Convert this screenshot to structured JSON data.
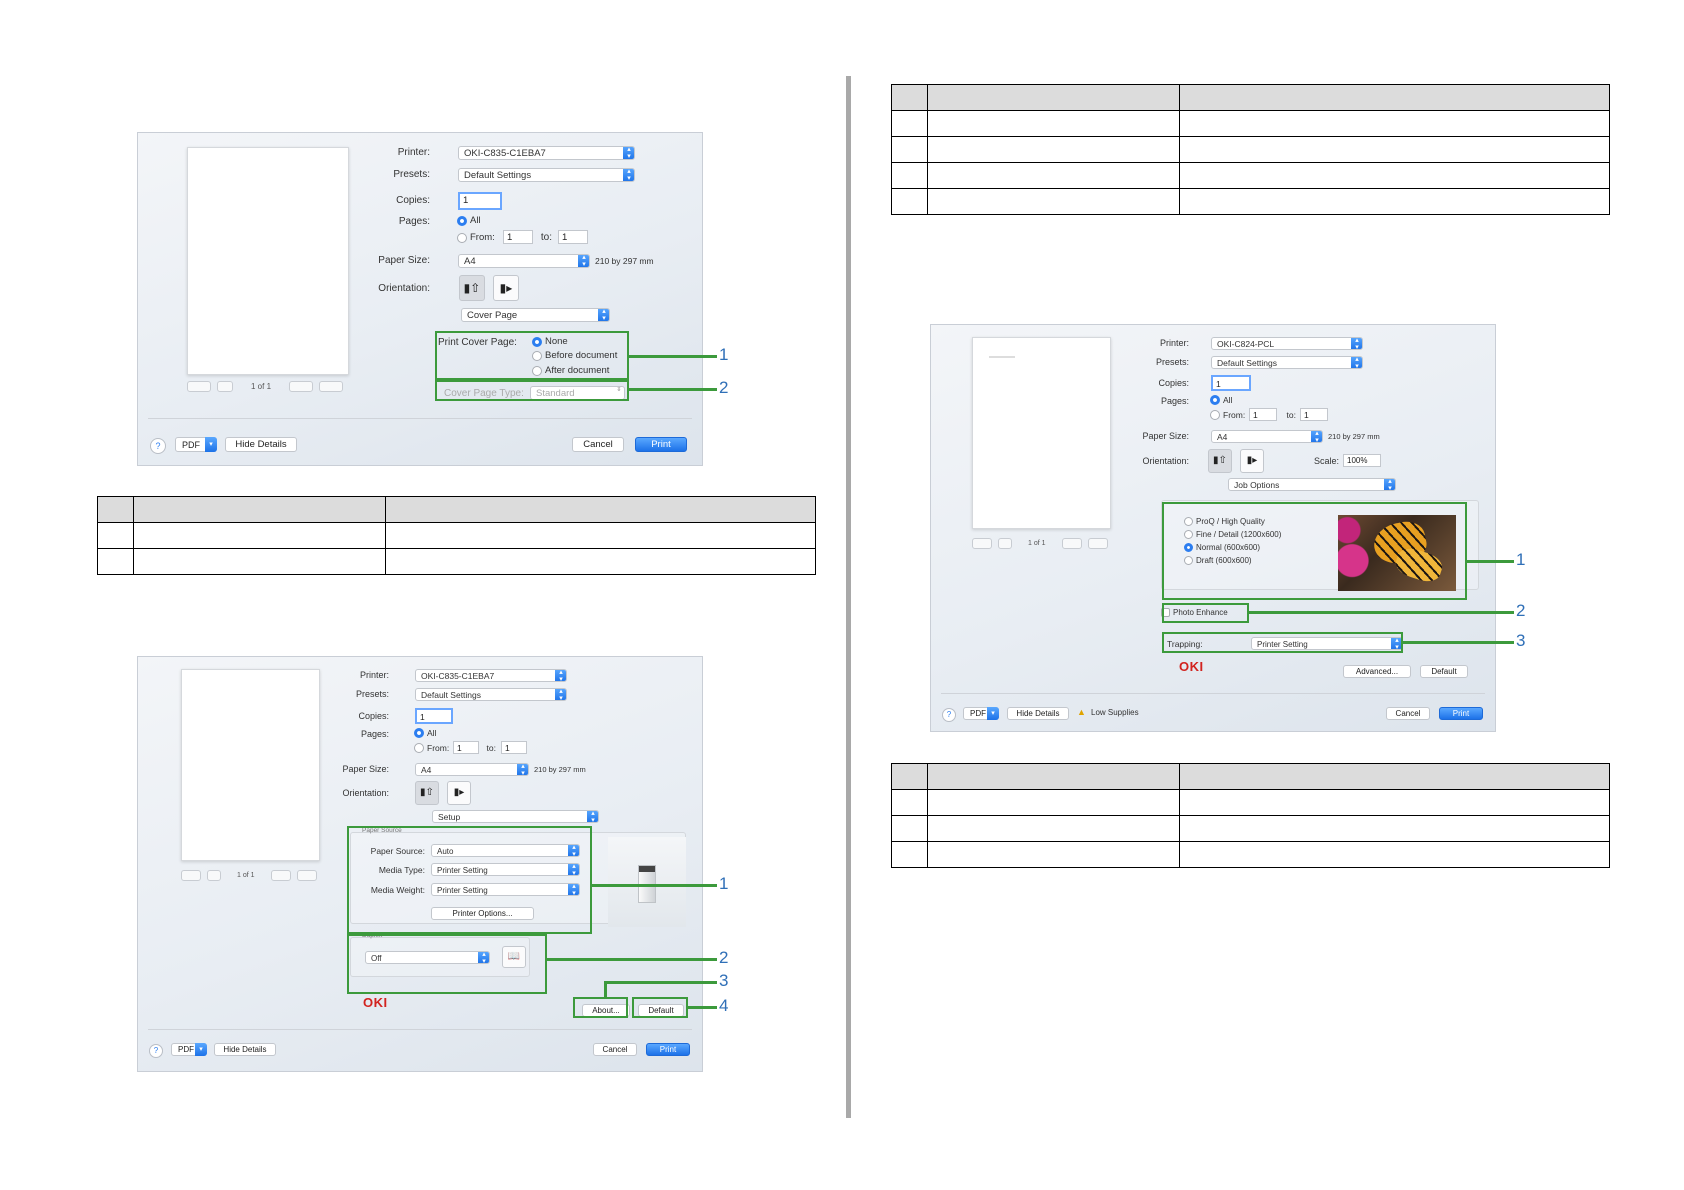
{
  "dialog_a": {
    "printer_label": "Printer:",
    "printer_value": "OKI-C835-C1EBA7",
    "presets_label": "Presets:",
    "presets_value": "Default Settings",
    "copies_label": "Copies:",
    "copies_value": "1",
    "pages_label": "Pages:",
    "pages_all": "All",
    "pages_from": "From:",
    "from_value": "1",
    "pages_to": "to:",
    "to_value": "1",
    "paper_size_label": "Paper Size:",
    "paper_size_value": "A4",
    "paper_size_dims": "210 by 297 mm",
    "orientation_label": "Orientation:",
    "panel_value": "Cover Page",
    "cover_page_label": "Print Cover Page:",
    "cover_none": "None",
    "cover_before": "Before document",
    "cover_after": "After document",
    "cover_type_label": "Cover Page Type:",
    "cover_type_value": "Standard",
    "page_count": "1 of 1",
    "pdf": "PDF",
    "hide_details": "Hide Details",
    "cancel": "Cancel",
    "print": "Print",
    "help": "?",
    "callouts": [
      "1",
      "2"
    ]
  },
  "dialog_b": {
    "printer_label": "Printer:",
    "printer_value": "OKI-C835-C1EBA7",
    "presets_label": "Presets:",
    "presets_value": "Default Settings",
    "copies_label": "Copies:",
    "copies_value": "1",
    "pages_label": "Pages:",
    "pages_all": "All",
    "pages_from": "From:",
    "from_value": "1",
    "pages_to": "to:",
    "to_value": "1",
    "paper_size_label": "Paper Size:",
    "paper_size_value": "A4",
    "paper_size_dims": "210 by 297 mm",
    "orientation_label": "Orientation:",
    "panel_value": "Setup",
    "paper_source_group": "Paper Source",
    "paper_source_label": "Paper Source:",
    "paper_source_value": "Auto",
    "media_type_label": "Media Type:",
    "media_type_value": "Printer Setting",
    "media_weight_label": "Media Weight:",
    "media_weight_value": "Printer Setting",
    "printer_options": "Printer Options...",
    "duplex_group": "Duplex",
    "duplex_value": "Off",
    "about": "About...",
    "default": "Default",
    "logo": "OKI",
    "page_count": "1 of 1",
    "pdf": "PDF",
    "hide_details": "Hide Details",
    "cancel": "Cancel",
    "print": "Print",
    "help": "?",
    "callouts": [
      "1",
      "2",
      "3",
      "4"
    ]
  },
  "dialog_c": {
    "printer_label": "Printer:",
    "printer_value": "OKI-C824-PCL",
    "presets_label": "Presets:",
    "presets_value": "Default Settings",
    "copies_label": "Copies:",
    "copies_value": "1",
    "pages_label": "Pages:",
    "pages_all": "All",
    "pages_from": "From:",
    "from_value": "1",
    "pages_to": "to:",
    "to_value": "1",
    "paper_size_label": "Paper Size:",
    "paper_size_value": "A4",
    "paper_size_dims": "210 by 297 mm",
    "orientation_label": "Orientation:",
    "scale_label": "Scale:",
    "scale_value": "100%",
    "panel_value": "Job Options",
    "q_proq": "ProQ / High Quality",
    "q_fine": "Fine / Detail (1200x600)",
    "q_normal": "Normal (600x600)",
    "q_draft": "Draft (600x600)",
    "photo_enhance": "Photo Enhance",
    "trapping_label": "Trapping:",
    "trapping_value": "Printer Setting",
    "advanced": "Advanced...",
    "default": "Default",
    "logo": "OKI",
    "low_supplies": "Low Supplies",
    "page_count": "1 of 1",
    "pdf": "PDF",
    "hide_details": "Hide Details",
    "cancel": "Cancel",
    "print": "Print",
    "help": "?",
    "callouts": [
      "1",
      "2",
      "3"
    ]
  },
  "colors": {
    "callout_box": "#3c9a3c",
    "callout_number": "#2f6fb7",
    "accent": "#2c7ef0",
    "logo": "#d2231f"
  },
  "icons": [
    "portrait-icon",
    "landscape-icon",
    "printer-icon",
    "butterfly-preview",
    "book-duplex-icon",
    "warning-icon"
  ]
}
